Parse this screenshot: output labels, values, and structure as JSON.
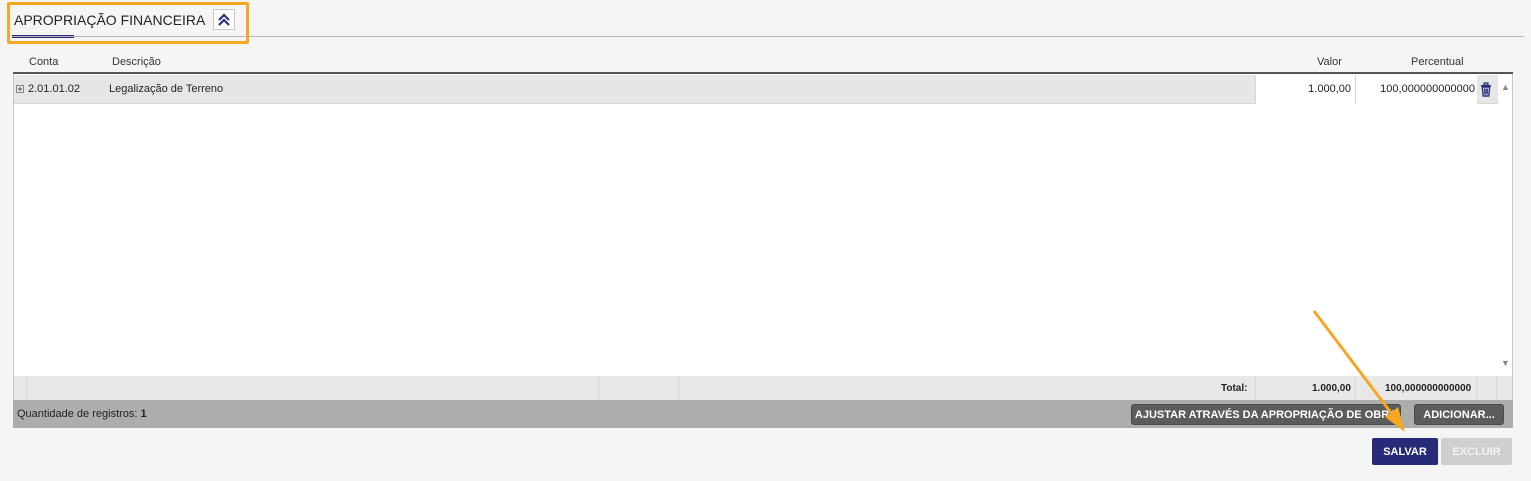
{
  "section": {
    "title": "APROPRIAÇÃO FINANCEIRA"
  },
  "grid": {
    "columns": {
      "conta": "Conta",
      "descricao": "Descrição",
      "valor": "Valor",
      "percentual": "Percentual"
    },
    "rows": [
      {
        "conta": "2.01.01.02",
        "descricao": "Legalização de Terreno",
        "valor": "1.000,00",
        "percentual": "100,000000000000"
      }
    ],
    "footer": {
      "total_label": "Total:",
      "total_valor": "1.000,00",
      "total_percentual": "100,000000000000"
    },
    "record_count_label": "Quantidade de registros:",
    "record_count": "1",
    "adjust_button": "AJUSTAR ATRAVÉS DA APROPRIAÇÃO DE OBRA",
    "add_button": "ADICIONAR..."
  },
  "actions": {
    "save": "SALVAR",
    "delete": "EXCLUIR"
  },
  "colors": {
    "accent": "#262a78",
    "highlight": "#f5a623"
  }
}
